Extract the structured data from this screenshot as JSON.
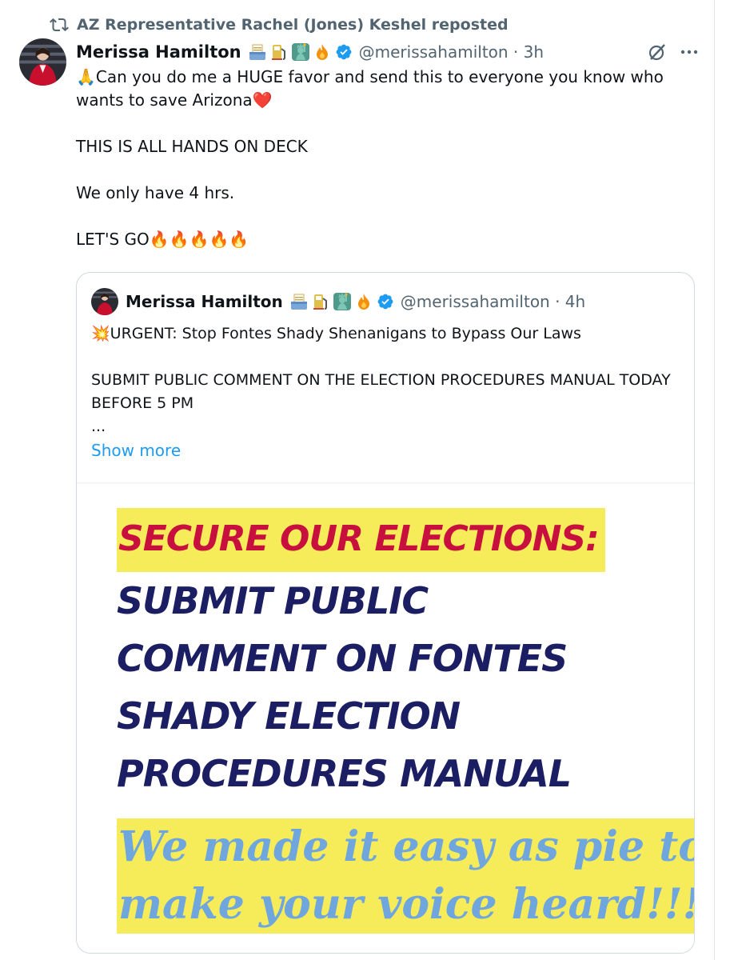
{
  "repost": {
    "text": "AZ Representative Rachel (Jones) Keshel reposted",
    "icon": "repost-icon"
  },
  "post": {
    "author_name": "Merissa Hamilton",
    "emoji_badges": [
      "inbox-tray-emoji",
      "fuel-pump-emoji",
      "statue-of-liberty-emoji",
      "fire-emoji"
    ],
    "verified": true,
    "handle": "@merissahamilton · 3h",
    "text": "🙏Can you do me a HUGE favor and send this to everyone you know who wants to save Arizona❤️\n\nTHIS IS ALL HANDS ON DECK\n\nWe only have 4 hrs.\n\nLET'S GO🔥🔥🔥🔥🔥",
    "actions": [
      "grok-icon",
      "more-icon"
    ]
  },
  "quote": {
    "author_name": "Merissa Hamilton",
    "emoji_badges": [
      "inbox-tray-emoji",
      "fuel-pump-emoji",
      "statue-of-liberty-emoji",
      "fire-emoji"
    ],
    "verified": true,
    "handle": "@merissahamilton · 4h",
    "text": "💥URGENT: Stop Fontes Shady Shenanigans to Bypass Our Laws\n\nSUBMIT PUBLIC COMMENT ON THE ELECTION PROCEDURES MANUAL TODAY BEFORE 5 PM\n...",
    "show_more": "Show more"
  },
  "flyer": {
    "headline": "SECURE OUR ELECTIONS:",
    "body_lines": [
      "SUBMIT PUBLIC",
      "COMMENT ON FONTES",
      "SHADY ELECTION",
      "PROCEDURES MANUAL"
    ],
    "tag_lines": [
      "We made it easy as pie to",
      "make your voice heard!!!!"
    ]
  },
  "colors": {
    "handle_gray": "#536471",
    "link_blue": "#1d9bf0",
    "highlight_yellow": "#f6ec5a",
    "headline_red": "#c8103e",
    "body_navy": "#1c1e63",
    "tag_blue": "#6fa6de"
  }
}
